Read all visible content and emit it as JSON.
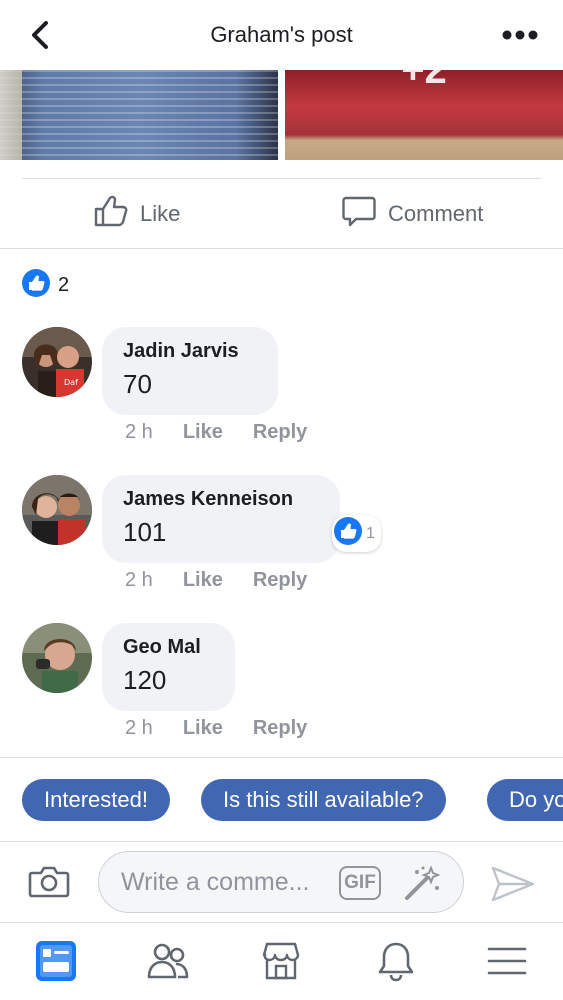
{
  "header": {
    "title": "Graham's post"
  },
  "photos": {
    "overlay_text": "+2"
  },
  "actions": {
    "like_label": "Like",
    "comment_label": "Comment"
  },
  "reactions": {
    "count": "2"
  },
  "comments": [
    {
      "author": "Jadin Jarvis",
      "text": "70",
      "time": "2 h",
      "like": "Like",
      "reply": "Reply"
    },
    {
      "author": "James Kenneison",
      "text": "101",
      "time": "2 h",
      "like": "Like",
      "reply": "Reply",
      "reaction_count": "1"
    },
    {
      "author": "Geo Mal",
      "text": "120",
      "time": "2 h",
      "like": "Like",
      "reply": "Reply"
    }
  ],
  "quick_replies": [
    "Interested!",
    "Is this still available?",
    "Do you deliver?"
  ],
  "composer": {
    "placeholder": "Write a comme...",
    "gif_label": "GIF"
  },
  "colors": {
    "accent": "#4267b2",
    "like_blue": "#1877f2",
    "bubble_bg": "#f0f2f5",
    "muted_text": "#90949c"
  },
  "icons": [
    "back-icon",
    "more-icon",
    "like-thumb-icon",
    "comment-icon",
    "camera-icon",
    "gif-icon",
    "magic-wand-icon",
    "send-icon",
    "news-feed-icon",
    "friends-icon",
    "marketplace-icon",
    "notifications-icon",
    "menu-icon"
  ]
}
